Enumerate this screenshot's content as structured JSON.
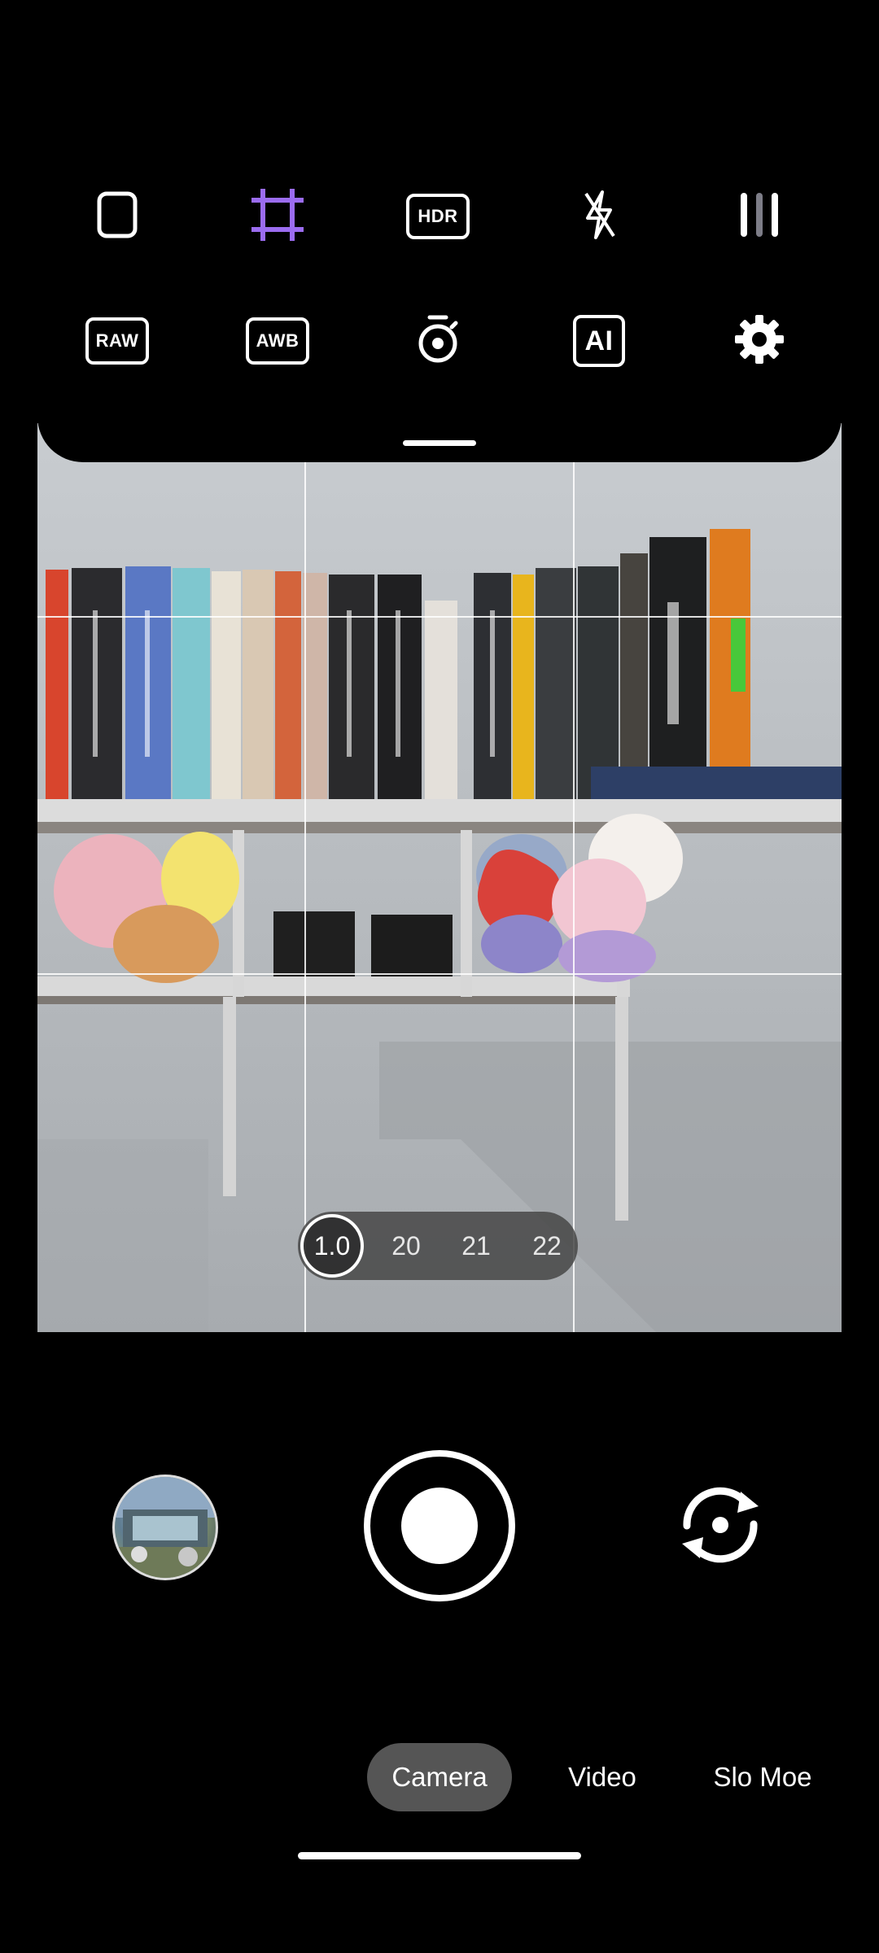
{
  "quick_settings": {
    "row1": {
      "hdr_label": "HDR",
      "icons": [
        "aspect-ratio-icon",
        "crop-frame-icon",
        "hdr-icon",
        "flash-auto-icon",
        "grid-lines-icon"
      ]
    },
    "row2": {
      "raw_label": "RAW",
      "awb_label": "AWB",
      "ai_label": "AI",
      "icons": [
        "raw-icon",
        "awb-icon",
        "timer-icon",
        "ai-icon",
        "settings-gear-icon"
      ]
    },
    "accent_color": "#9b6cf0"
  },
  "viewfinder": {
    "description_icons": [
      "bookshelf-scene"
    ],
    "zoom": {
      "active": "1.0",
      "levels": [
        "20",
        "21",
        "22"
      ]
    }
  },
  "controls": {
    "icons": [
      "gallery-thumbnail",
      "shutter-button",
      "switch-camera-icon"
    ]
  },
  "modes": {
    "items": [
      "Camera",
      "Video",
      "Slo Moe"
    ],
    "active": "Camera"
  }
}
